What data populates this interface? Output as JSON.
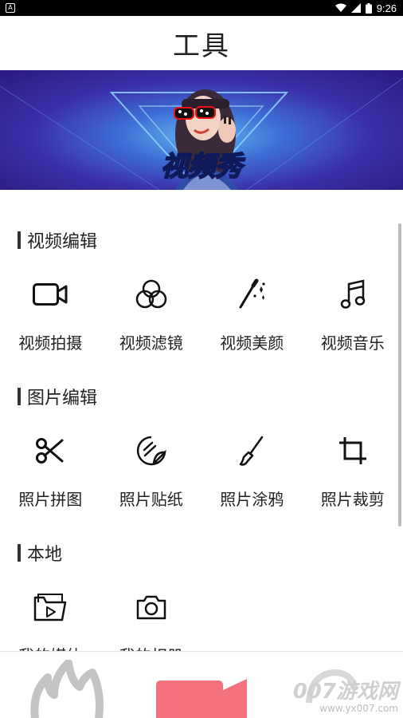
{
  "status_bar": {
    "time": "9:26"
  },
  "header": {
    "title": "工具"
  },
  "banner": {
    "text": "视频秀"
  },
  "sections": [
    {
      "title": "视频编辑",
      "items": [
        {
          "label": "视频拍摄",
          "icon": "video-camera-icon"
        },
        {
          "label": "视频滤镜",
          "icon": "filter-circles-icon"
        },
        {
          "label": "视频美颜",
          "icon": "magic-wand-icon"
        },
        {
          "label": "视频音乐",
          "icon": "music-note-icon"
        }
      ]
    },
    {
      "title": "图片编辑",
      "items": [
        {
          "label": "照片拼图",
          "icon": "scissors-icon"
        },
        {
          "label": "照片贴纸",
          "icon": "sticker-icon"
        },
        {
          "label": "照片涂鸦",
          "icon": "paintbrush-icon"
        },
        {
          "label": "照片裁剪",
          "icon": "crop-icon"
        }
      ]
    },
    {
      "title": "本地",
      "items": [
        {
          "label": "我的媒体",
          "icon": "media-folder-icon"
        },
        {
          "label": "我的相册",
          "icon": "camera-icon"
        }
      ]
    }
  ],
  "watermark": {
    "title": "007游戏网",
    "url": "www.yx007.com"
  },
  "colors": {
    "banner": "#3a2fa8",
    "tab_center": "#f2717d",
    "scrollbar": "#bdbdbd"
  }
}
